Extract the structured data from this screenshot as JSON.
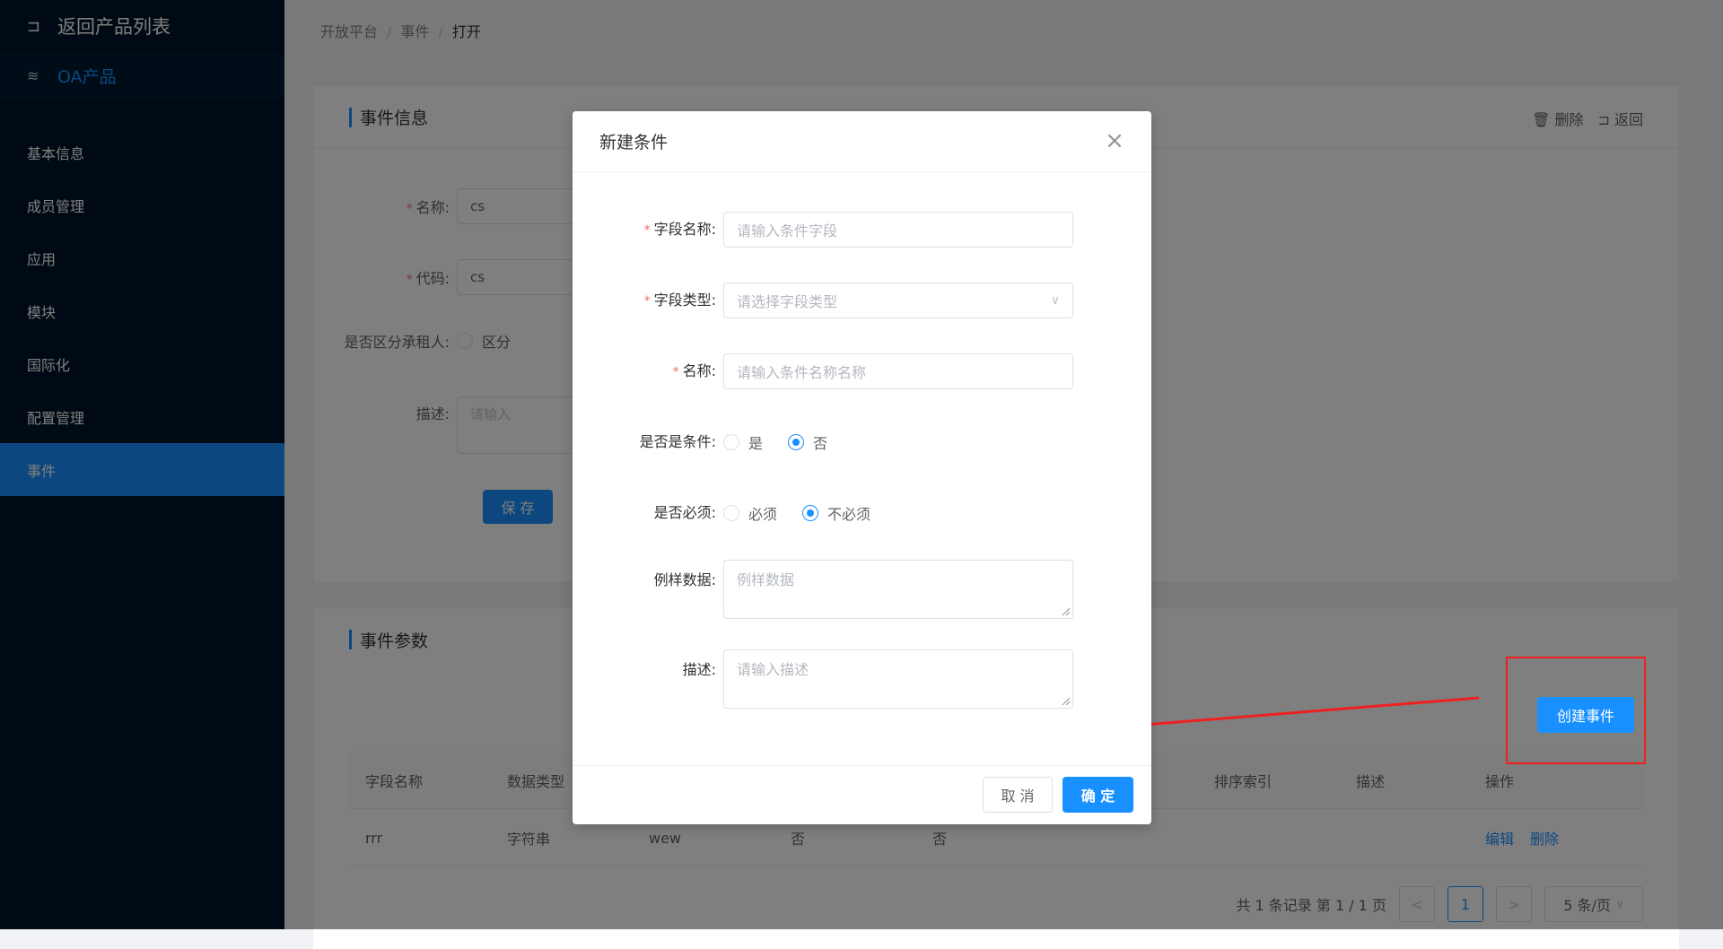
{
  "sidebar": {
    "back_label": "返回产品列表",
    "product_label": "OA产品",
    "items": [
      {
        "label": "基本信息"
      },
      {
        "label": "成员管理"
      },
      {
        "label": "应用"
      },
      {
        "label": "模块"
      },
      {
        "label": "国际化"
      },
      {
        "label": "配置管理"
      },
      {
        "label": "事件"
      }
    ],
    "active_item": "事件"
  },
  "breadcrumb": [
    "开放平台",
    "事件",
    "打开"
  ],
  "event_info": {
    "title": "事件信息",
    "actions": {
      "delete": "删除",
      "back": "返回"
    },
    "name_label": "名称:",
    "name_value": "cs",
    "code_label": "代码:",
    "code_value": "cs",
    "tenant_label": "是否区分承租人:",
    "tenant_option": "区分",
    "desc_label": "描述:",
    "desc_placeholder": "请输入",
    "save_label": "保 存"
  },
  "event_params": {
    "title": "事件参数",
    "create_button": "创建事件",
    "columns": [
      "字段名称",
      "数据类型",
      "排序索引",
      "描述",
      "操作"
    ],
    "rows": [
      {
        "field": "rrr",
        "type": "字符串",
        "name": "wew",
        "is_condition": "否",
        "required": "否",
        "edit": "编辑",
        "delete": "删除"
      }
    ],
    "pagination": {
      "summary": "共 1 条记录 第 1 / 1 页",
      "prev": "<",
      "current_page": "1",
      "next": ">",
      "page_size": "5 条/页"
    }
  },
  "dialog": {
    "title": "新建条件",
    "close": "×",
    "field_name_label": "字段名称:",
    "field_name_placeholder": "请输入条件字段",
    "field_type_label": "字段类型:",
    "field_type_placeholder": "请选择字段类型",
    "name_label": "名称:",
    "name_placeholder": "请输入条件名称名称",
    "is_condition_label": "是否是条件:",
    "is_condition_yes": "是",
    "is_condition_no": "否",
    "is_condition_selected": "否",
    "required_label": "是否必须:",
    "required_yes": "必须",
    "required_no": "不必须",
    "required_selected": "不必须",
    "sample_label": "例样数据:",
    "sample_placeholder": "例样数据",
    "desc_label": "描述:",
    "desc_placeholder": "请输入描述",
    "cancel_label": "取 消",
    "ok_label": "确 定"
  },
  "icons": {
    "back": "return-icon",
    "product": "layers-icon",
    "delete": "trash-icon",
    "return": "return-icon",
    "close": "close-icon",
    "chevron": "chevron-down-icon"
  },
  "colors": {
    "sidebar_bg": "#001529",
    "accent": "#1890ff",
    "required": "#f56c6c",
    "annotation": "#f02020"
  }
}
